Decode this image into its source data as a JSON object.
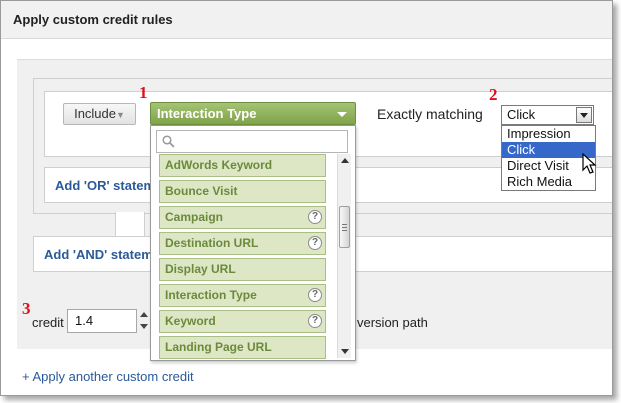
{
  "panel": {
    "title": "Apply custom credit rules"
  },
  "steps": {
    "one": "1",
    "two": "2",
    "three": "3"
  },
  "rule": {
    "include_label": "Include",
    "dimension_selected": "Interaction Type",
    "match_label": "Exactly matching",
    "value_selected": "Click",
    "value_options": [
      "Impression",
      "Click",
      "Direct Visit",
      "Rich Media"
    ],
    "value_highlighted": "Click"
  },
  "dimension_dropdown": {
    "search_placeholder": "",
    "options": [
      {
        "label": "AdWords Keyword",
        "help": false
      },
      {
        "label": "Bounce Visit",
        "help": false
      },
      {
        "label": "Campaign",
        "help": true
      },
      {
        "label": "Destination URL",
        "help": true
      },
      {
        "label": "Display URL",
        "help": false
      },
      {
        "label": "Interaction Type",
        "help": true
      },
      {
        "label": "Keyword",
        "help": true
      },
      {
        "label": "Landing Page URL",
        "help": false
      }
    ],
    "help_glyph": "?"
  },
  "links": {
    "add_or": "Add 'OR' statem",
    "add_and": "Add 'AND' statem",
    "apply_another": "+ Apply another custom credit"
  },
  "credit": {
    "label": "credit",
    "value": "1.4",
    "path_suffix": "version path"
  },
  "colors": {
    "step_marker": "#e0101a",
    "dimension_green": "#8aad52",
    "option_text": "#6b8a3c",
    "link_blue": "#2a5a99",
    "selection_blue": "#3568c8"
  }
}
